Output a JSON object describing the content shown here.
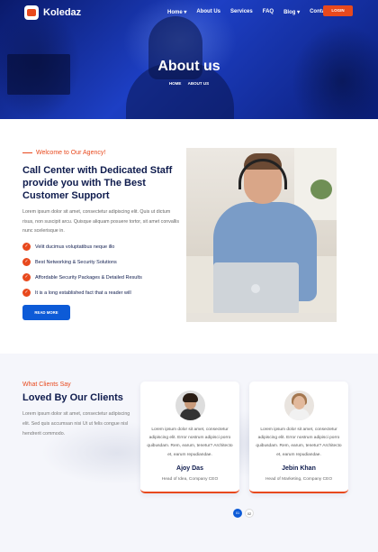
{
  "header": {
    "logo_text": "Koledaz",
    "nav": [
      "Home ▾",
      "About Us",
      "Services",
      "FAQ",
      "Blog ▾",
      "Contact"
    ],
    "login_label": "LOGIN"
  },
  "hero": {
    "title": "About us",
    "breadcrumb": [
      "HOME",
      "ABOUT US"
    ]
  },
  "about": {
    "tagline": "Welcome to Our Agency!",
    "heading": "Call Center with Dedicated Staff provide you with The Best Customer Support",
    "paragraph": "Lorem ipsum dolor sit amet, consectetur adipiscing elit. Quis ut dictum risus, non suscipit arcu. Quisque aliquam posuere tortor, sit amet convallis nunc scelerisque in.",
    "features": [
      "Velit ducimus voluptatibus neque illo",
      "Best Networking & Security Solutions",
      "Affordable Security Packages & Detailed Results",
      "It is a long established fact that a reader will"
    ],
    "button_label": "READ MORE"
  },
  "testimonials": {
    "tagline": "What Clients Say",
    "heading": "Loved By Our Clients",
    "paragraph": "Lorem ipsum dolor sit amet, consectetur adipiscing elit. Sed quis accumsan nisi Ut ut felis congue nisl hendrerit commodo.",
    "cards": [
      {
        "quote": "Lorem ipsum dolor sit amet, consectetur adipiscing elit. Error nostrum adipisci porro quibusdam. Rem, earum, tenetur? Architecto et, earum repudiandae.",
        "name": "Ajoy Das",
        "role": "Head of Idea, Company CEO"
      },
      {
        "quote": "Lorem ipsum dolor sit amet, consectetur adipiscing elit. Error nostrum adipisci porro quibusdam. Rem, earum, tenetur? Architecto et, earum repudiandae.",
        "name": "Jebin Khan",
        "role": "Head of Marketing, Company CEO"
      }
    ],
    "pagination": [
      "01",
      "02"
    ]
  },
  "colors": {
    "accent": "#e8491d",
    "primary": "#0d5bd7",
    "heading": "#0e1b4d"
  }
}
